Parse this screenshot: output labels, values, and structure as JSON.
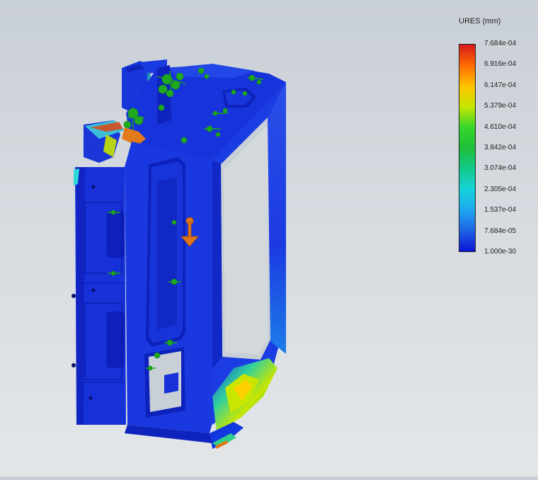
{
  "legend": {
    "title": "URES (mm)",
    "labels": [
      "7.684e-04",
      "6.916e-04",
      "6.147e-04",
      "5.379e-04",
      "4.610e-04",
      "3.842e-04",
      "3.074e-04",
      "2.305e-04",
      "1.537e-04",
      "7.684e-05",
      "1.000e-30"
    ],
    "colors": [
      "#d7191c",
      "#ff6a00",
      "#ffc300",
      "#c8e600",
      "#35d62b",
      "#1fbf3a",
      "#12c98a",
      "#15d2d8",
      "#1fa8f0",
      "#1f63e6",
      "#0a14d6"
    ]
  }
}
